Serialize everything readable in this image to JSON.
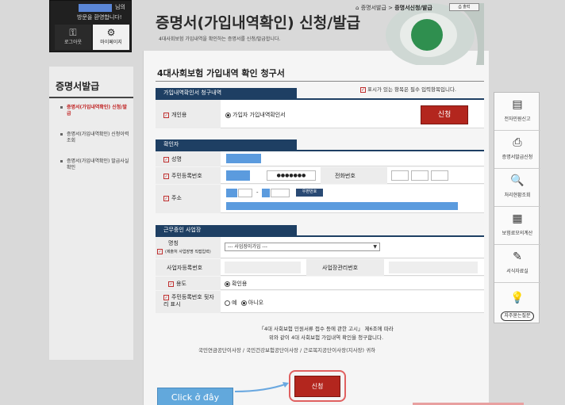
{
  "user": {
    "name_suffix": "님의",
    "welcome": "방문을 환영합니다!",
    "logout_label": "로그아웃",
    "mypage_label": "마이페이지"
  },
  "left_menu": {
    "title": "증명서발급",
    "items": [
      {
        "label": "증명서(가입내역확인) 신청/발급",
        "active": true
      },
      {
        "label": "증명서(가입내역확인) 신청이력 조회",
        "active": false
      },
      {
        "label": "증명서(가입내역확인) 발급사실 확인",
        "active": false
      }
    ]
  },
  "header": {
    "title": "증명서(가입내역확인) 신청/발급",
    "subtitle": "4대사회보험 가입내역을 확인하는 증명서를 신청/발급합니다.",
    "breadcrumb": [
      "증명서발급",
      "증명서신청/발급"
    ],
    "print_label": "출력"
  },
  "form": {
    "section_title": "4대사회보험 가입내역 확인 청구서",
    "required_note": "표시가 있는 항목은 필수 입력항목입니다.",
    "required_mark": "✓",
    "sec1": {
      "head": "가입내역확인서 청구내역",
      "label": "개인용",
      "option": "가입자 가입내역확인서",
      "apply_label": "신청"
    },
    "sec2": {
      "head": "확인자",
      "name_label": "성명",
      "rrn_label": "주민등록번호",
      "rrn_mask": "●●●●●●●",
      "phone_label": "전화번호",
      "address_label": "주소",
      "address_dash": "-",
      "zip_btn": "우편번호"
    },
    "sec3": {
      "head": "근무중인 사업장",
      "workplace_label": "명칭",
      "workplace_sub": "(제출처 사업장명 직접입력)",
      "workplace_select": "--- 사업장미가입 ---",
      "biz_no_label": "사업자등록번호",
      "mgmt_no_label": "사업장관리번호",
      "purpose_label": "용도",
      "purpose_option": "확인용",
      "rrn_show_label": "주민등록번호 뒷자리 표시",
      "rrn_show_yes": "예",
      "rrn_show_no": "아니오"
    },
    "notice_lines": [
      "「4대 사회보험 민원서류 접수 등에 관한 고시」 제6조에 따라",
      "위와 같이 4대 사회보험 가입내역 확인을 청구합니다."
    ],
    "orgs": "국민연금공단이사장 / 국민건강보험공단이사장 / 근로복지공단이사장(지사장) 귀하",
    "apply_bottom_label": "신청"
  },
  "overlay": {
    "click_here": "Click ở đây"
  },
  "right_sidebar": {
    "items": [
      {
        "label": "전자민원신고",
        "icon": "document-icon",
        "glyph": "▤"
      },
      {
        "label": "증명서발급신청",
        "icon": "printer-icon",
        "glyph": "⎙"
      },
      {
        "label": "처리현황조회",
        "icon": "search-doc-icon",
        "glyph": "🔍"
      },
      {
        "label": "보험료모의계산",
        "icon": "calculator-icon",
        "glyph": "▦"
      },
      {
        "label": "서식자료실",
        "icon": "form-icon",
        "glyph": "✎"
      }
    ],
    "faq": {
      "label": "자주묻는질문",
      "icon": "lightbulb-icon",
      "glyph": "💡"
    }
  },
  "colors": {
    "section_head": "#1e3f63",
    "apply_button": "#b3261e",
    "masked_blue": "#5b9bde",
    "click_here_bg": "#62a8dc"
  }
}
